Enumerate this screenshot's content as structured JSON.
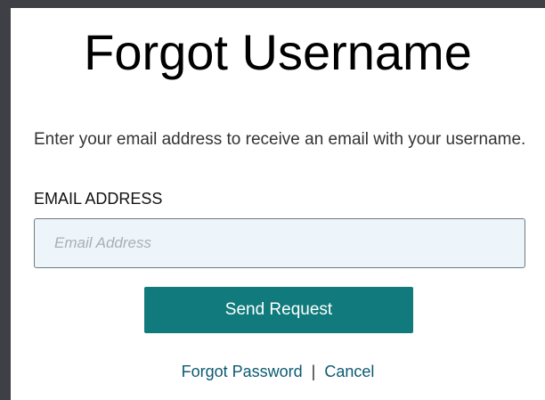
{
  "page": {
    "title": "Forgot Username",
    "instructions": "Enter your email address to receive an email with your username."
  },
  "form": {
    "email_label": "EMAIL ADDRESS",
    "email_placeholder": "Email Address",
    "email_value": "",
    "submit_label": "Send Request"
  },
  "links": {
    "forgot_password": "Forgot Password",
    "separator": "|",
    "cancel": "Cancel"
  },
  "colors": {
    "button_bg": "#117a7c",
    "link": "#0b5a72",
    "frame": "#3e4046",
    "input_bg": "#eef5fa"
  }
}
